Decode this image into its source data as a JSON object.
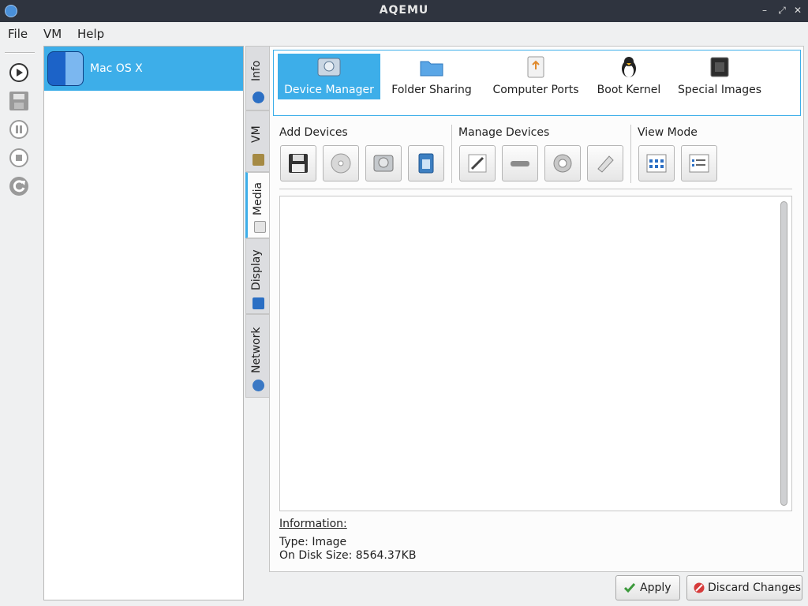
{
  "window": {
    "title": "AQEMU"
  },
  "menu": {
    "file": "File",
    "vm": "VM",
    "help": "Help"
  },
  "vm_list": {
    "items": [
      {
        "label": "Mac OS X",
        "selected": true
      }
    ]
  },
  "side_tabs": [
    {
      "label": "Info"
    },
    {
      "label": "VM"
    },
    {
      "label": "Media",
      "active": true
    },
    {
      "label": "Display"
    },
    {
      "label": "Network"
    }
  ],
  "top_nav": [
    {
      "label": "Device Manager",
      "icon": "hard-disk-icon",
      "active": true
    },
    {
      "label": "Folder Sharing",
      "icon": "folder-icon"
    },
    {
      "label": "Computer Ports",
      "icon": "usb-drive-icon"
    },
    {
      "label": "Boot Kernel",
      "icon": "tux-linux-icon"
    },
    {
      "label": "Special Images",
      "icon": "chip-icon"
    }
  ],
  "groups": {
    "add_devices": "Add Devices",
    "manage_devices": "Manage Devices",
    "view_mode": "View Mode"
  },
  "information": {
    "heading": "Information:",
    "type": "Type: Image",
    "size": "On Disk Size: 8564.37KB"
  },
  "buttons": {
    "apply": "Apply",
    "discard": "Discard Changes"
  },
  "colors": {
    "accent": "#3daee9",
    "titlebar": "#2f343f"
  }
}
